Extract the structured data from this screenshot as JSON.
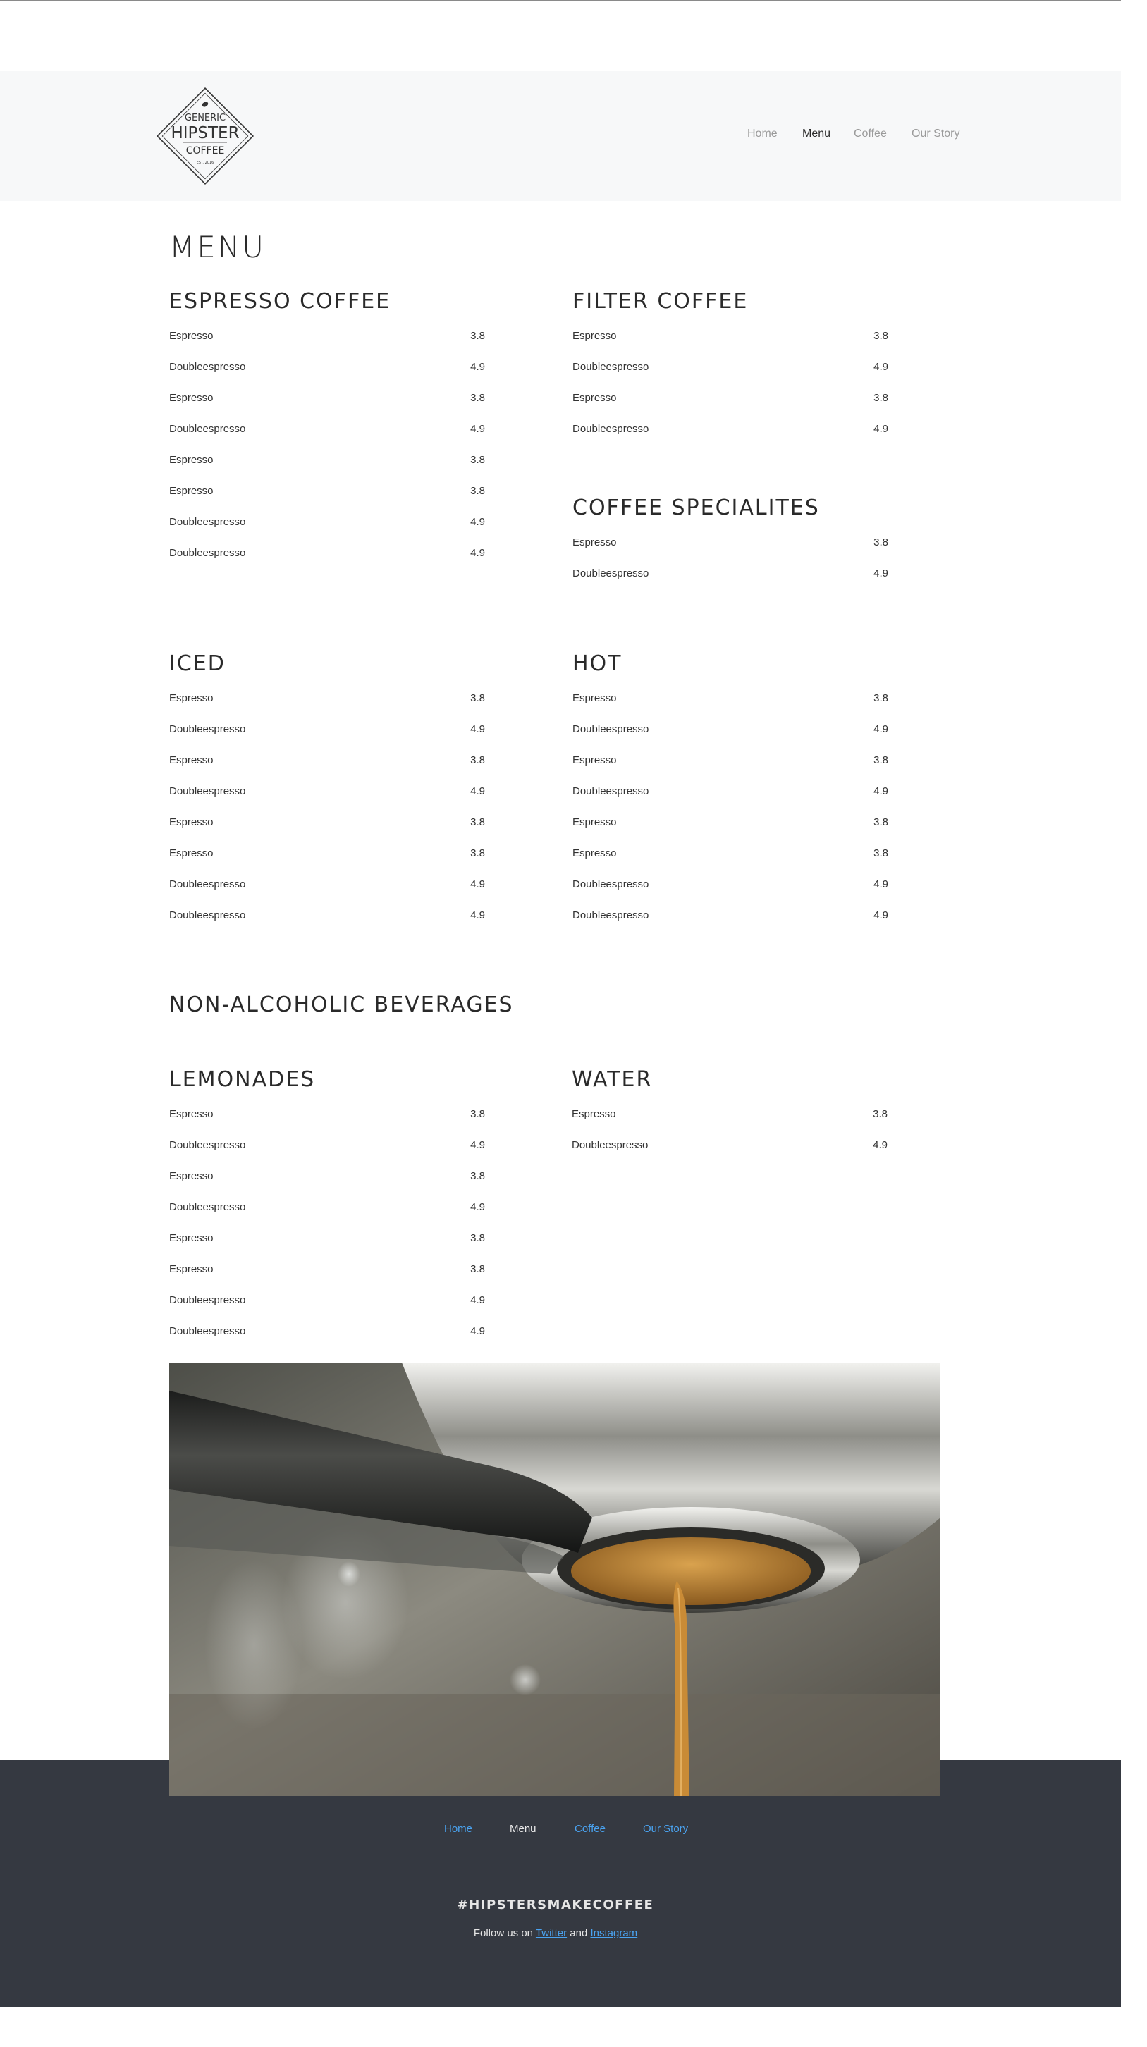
{
  "logo": {
    "line1": "GENERIC",
    "line2": "HIPSTER",
    "line3": "COFFEE",
    "line4": "EST. 2016"
  },
  "nav": [
    {
      "label": "Home",
      "active": false
    },
    {
      "label": "Menu",
      "active": true
    },
    {
      "label": "Coffee",
      "active": false
    },
    {
      "label": "Our Story",
      "active": false
    }
  ],
  "menu": {
    "title": "MENU",
    "espresso": {
      "title": "ESPRESSO COFFEE",
      "items": [
        {
          "name": "Espresso",
          "price": "3.8"
        },
        {
          "name": "Doubleespresso",
          "price": "4.9"
        },
        {
          "name": "Espresso",
          "price": "3.8"
        },
        {
          "name": "Doubleespresso",
          "price": "4.9"
        },
        {
          "name": "Espresso",
          "price": "3.8"
        },
        {
          "name": "Espresso",
          "price": "3.8"
        },
        {
          "name": "Doubleespresso",
          "price": "4.9"
        },
        {
          "name": "Doubleespresso",
          "price": "4.9"
        }
      ]
    },
    "filter": {
      "title": "FILTER COFFEE",
      "items": [
        {
          "name": "Espresso",
          "price": "3.8"
        },
        {
          "name": "Doubleespresso",
          "price": "4.9"
        },
        {
          "name": "Espresso",
          "price": "3.8"
        },
        {
          "name": "Doubleespresso",
          "price": "4.9"
        }
      ]
    },
    "specialites": {
      "title": "COFFEE SPECIALITES",
      "items": [
        {
          "name": "Espresso",
          "price": "3.8"
        },
        {
          "name": "Doubleespresso",
          "price": "4.9"
        }
      ]
    },
    "iced": {
      "title": "ICED",
      "items": [
        {
          "name": "Espresso",
          "price": "3.8"
        },
        {
          "name": "Doubleespresso",
          "price": "4.9"
        },
        {
          "name": "Espresso",
          "price": "3.8"
        },
        {
          "name": "Doubleespresso",
          "price": "4.9"
        },
        {
          "name": "Espresso",
          "price": "3.8"
        },
        {
          "name": "Espresso",
          "price": "3.8"
        },
        {
          "name": "Doubleespresso",
          "price": "4.9"
        },
        {
          "name": "Doubleespresso",
          "price": "4.9"
        }
      ]
    },
    "hot": {
      "title": "HOT",
      "items": [
        {
          "name": "Espresso",
          "price": "3.8"
        },
        {
          "name": "Doubleespresso",
          "price": "4.9"
        },
        {
          "name": "Espresso",
          "price": "3.8"
        },
        {
          "name": "Doubleespresso",
          "price": "4.9"
        },
        {
          "name": "Espresso",
          "price": "3.8"
        },
        {
          "name": "Espresso",
          "price": "3.8"
        },
        {
          "name": "Doubleespresso",
          "price": "4.9"
        },
        {
          "name": "Doubleespresso",
          "price": "4.9"
        }
      ]
    },
    "non_alcoholic_title": "NON-ALCOHOLIC BEVERAGES",
    "lemonades": {
      "title": "LEMONADES",
      "items": [
        {
          "name": "Espresso",
          "price": "3.8"
        },
        {
          "name": "Doubleespresso",
          "price": "4.9"
        },
        {
          "name": "Espresso",
          "price": "3.8"
        },
        {
          "name": "Doubleespresso",
          "price": "4.9"
        },
        {
          "name": "Espresso",
          "price": "3.8"
        },
        {
          "name": "Espresso",
          "price": "3.8"
        },
        {
          "name": "Doubleespresso",
          "price": "4.9"
        },
        {
          "name": "Doubleespresso",
          "price": "4.9"
        }
      ]
    },
    "water": {
      "title": "WATER",
      "items": [
        {
          "name": "Espresso",
          "price": "3.8"
        },
        {
          "name": "Doubleespresso",
          "price": "4.9"
        }
      ]
    }
  },
  "footer": {
    "nav": [
      {
        "label": "Home",
        "active": false
      },
      {
        "label": "Menu",
        "active": true
      },
      {
        "label": "Coffee",
        "active": false
      },
      {
        "label": "Our Story",
        "active": false
      }
    ],
    "hashtag": "#HIPSTERSMAKECOFFEE",
    "follow_prefix": "Follow us on ",
    "twitter": "Twitter",
    "and": " and ",
    "instagram": "Instagram"
  },
  "colors": {
    "header_bg": "#f7f8f9",
    "footer_bg": "#353941",
    "link": "#4aa3f0",
    "text": "#333333"
  }
}
